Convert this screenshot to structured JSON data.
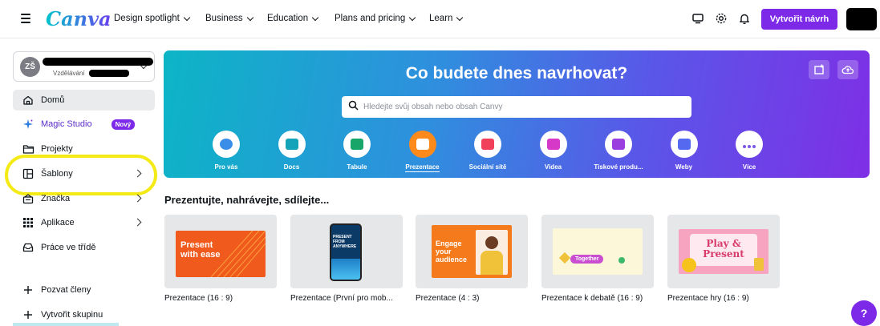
{
  "header": {
    "logo": "Canva",
    "nav": [
      "Design spotlight",
      "Business",
      "Education",
      "Plans and pricing",
      "Learn"
    ],
    "create_button": "Vytvořit návrh",
    "icons": [
      "monitor-icon",
      "gear-icon",
      "bell-icon"
    ]
  },
  "sidebar": {
    "account": {
      "initials": "ZŠ",
      "subtitle": "Vzdělávání"
    },
    "items": [
      {
        "label": "Domů",
        "icon": "home-icon"
      },
      {
        "label": "Magic Studio",
        "icon": "sparkle-icon",
        "badge": "Nový"
      },
      {
        "label": "Projekty",
        "icon": "folder-icon"
      },
      {
        "label": "Šablony",
        "icon": "templates-icon"
      },
      {
        "label": "Značka",
        "icon": "brand-icon"
      },
      {
        "label": "Aplikace",
        "icon": "apps-grid-icon"
      },
      {
        "label": "Práce ve třídě",
        "icon": "classroom-icon"
      }
    ],
    "actions": [
      {
        "label": "Pozvat členy"
      },
      {
        "label": "Vytvořit skupinu"
      }
    ]
  },
  "hero": {
    "title": "Co budete dnes navrhovat?",
    "search_placeholder": "Hledejte svůj obsah nebo obsah Canvy",
    "categories": [
      {
        "label": "Pro vás",
        "color": "#3b8ee8"
      },
      {
        "label": "Docs",
        "color": "#14a3b8"
      },
      {
        "label": "Tabule",
        "color": "#18a56a"
      },
      {
        "label": "Prezentace",
        "color": "#ff8a1c"
      },
      {
        "label": "Sociální sítě",
        "color": "#f0405a"
      },
      {
        "label": "Videa",
        "color": "#d639c8"
      },
      {
        "label": "Tiskové produ...",
        "color": "#9a3ee0"
      },
      {
        "label": "Weby",
        "color": "#5468f0"
      },
      {
        "label": "Více",
        "color": "#7c57e8"
      }
    ],
    "selected_category": "Prezentace"
  },
  "section": {
    "title": "Prezentujte, nahrávejte, sdílejte...",
    "cards": [
      {
        "title": "Prezentace (16 : 9)",
        "thumb_text": "Present with ease"
      },
      {
        "title": "Prezentace (První pro mob...",
        "thumb_text": "PRESENT FROM ANYWHERE"
      },
      {
        "title": "Prezentace (4 : 3)",
        "thumb_text": "Engage your audience"
      },
      {
        "title": "Prezentace k debatě (16 : 9)",
        "thumb_text": "Together"
      },
      {
        "title": "Prezentace hry (16 : 9)",
        "thumb_text": "Play & Present"
      }
    ]
  },
  "help_label": "?"
}
